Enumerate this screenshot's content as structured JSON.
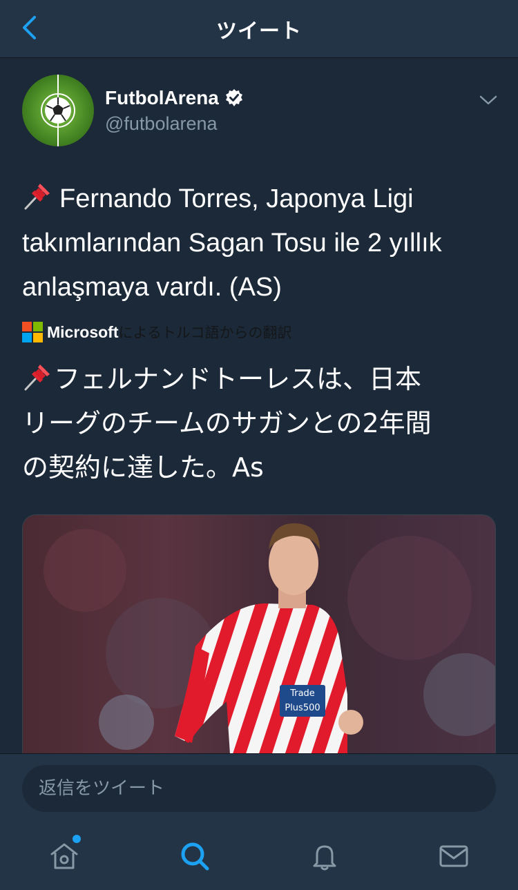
{
  "header": {
    "title": "ツイート"
  },
  "author": {
    "display_name": "FutbolArena",
    "handle": "@futbolarena",
    "verified": true
  },
  "tweet": {
    "text_line1": "Fernando Torres, Japonya Ligi",
    "text_line2": "takımlarından Sagan Tosu ile 2 yıllık",
    "text_line3": "anlaşmaya vardı. (AS)",
    "pin_icon": "pushpin-icon"
  },
  "translation": {
    "provider": "Microsoft",
    "label": "によるトルコ語からの翻訳",
    "line1": "フェルナンドトーレスは、日本",
    "line2": "リーグのチームのサガンとの2年間",
    "line3": "の契約に達した。As"
  },
  "reply": {
    "placeholder": "返信をツイート"
  },
  "tabs": [
    {
      "name": "home-icon",
      "active": false,
      "has_dot": true
    },
    {
      "name": "search-icon",
      "active": true
    },
    {
      "name": "bell-icon",
      "active": false
    },
    {
      "name": "mail-icon",
      "active": false
    }
  ],
  "colors": {
    "background": "#1c2938",
    "header": "#243447",
    "accent": "#1da1f2",
    "muted": "#8899a6"
  }
}
